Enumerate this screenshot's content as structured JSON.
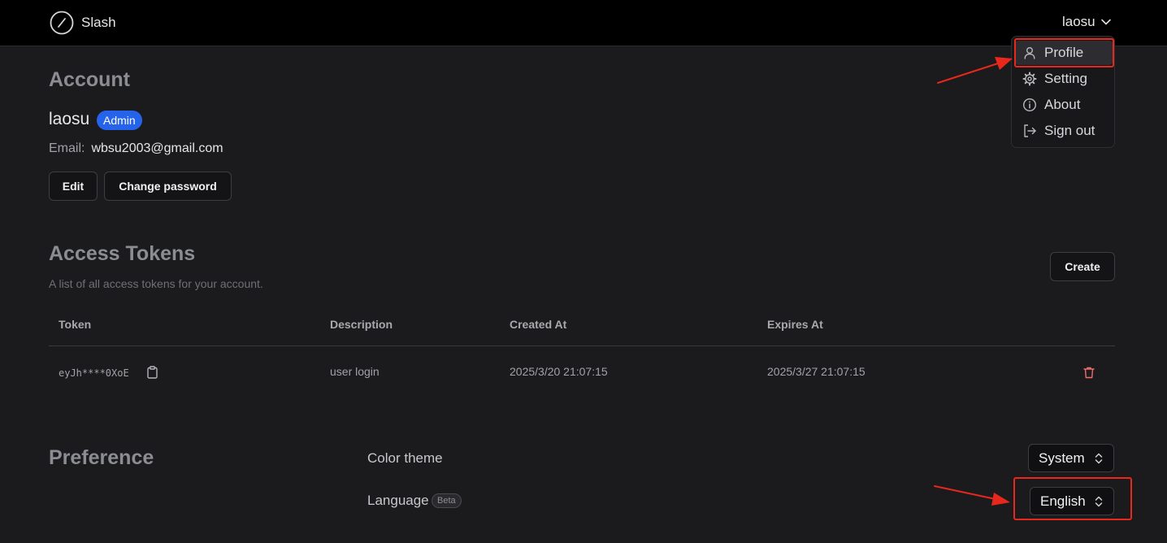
{
  "header": {
    "app_name": "Slash",
    "username": "laosu"
  },
  "user_dropdown": {
    "items": [
      {
        "label": "Profile",
        "icon": "user-icon"
      },
      {
        "label": "Setting",
        "icon": "gear-icon"
      },
      {
        "label": "About",
        "icon": "info-icon"
      },
      {
        "label": "Sign out",
        "icon": "sign-out-icon"
      }
    ]
  },
  "account": {
    "title": "Account",
    "username": "laosu",
    "role_badge": "Admin",
    "email_label": "Email:",
    "email": "wbsu2003@gmail.com",
    "edit_label": "Edit",
    "change_password_label": "Change password"
  },
  "tokens": {
    "title": "Access Tokens",
    "subtitle": "A list of all access tokens for your account.",
    "create_label": "Create",
    "columns": [
      "Token",
      "Description",
      "Created At",
      "Expires At"
    ],
    "rows": [
      {
        "token": "eyJh****0XoE",
        "description": "user login",
        "created_at": "2025/3/20 21:07:15",
        "expires_at": "2025/3/27 21:07:15"
      }
    ]
  },
  "preference": {
    "title": "Preference",
    "color_theme_label": "Color theme",
    "color_theme_value": "System",
    "language_label": "Language",
    "language_badge": "Beta",
    "language_value": "English"
  },
  "colors": {
    "accent": "#2563eb",
    "highlight": "#e8271d",
    "danger": "#f26d6d",
    "background": "#1b1b1d",
    "topbar": "#000000"
  }
}
